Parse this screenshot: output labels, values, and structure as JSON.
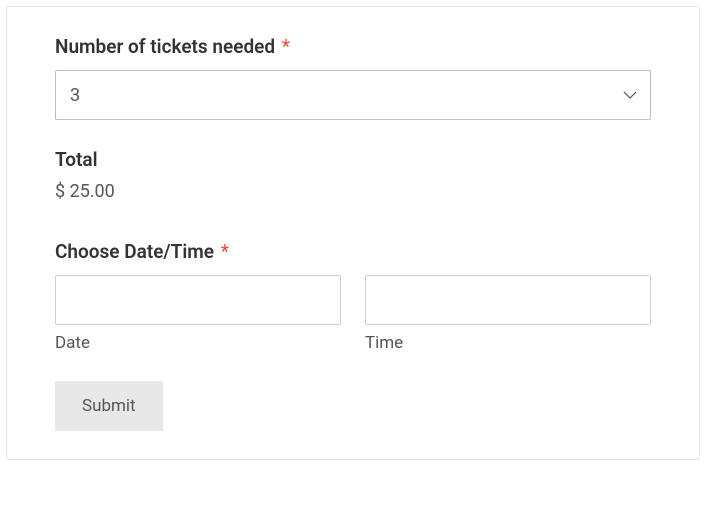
{
  "tickets": {
    "label": "Number of tickets needed",
    "required": "*",
    "value": "3"
  },
  "total": {
    "label": "Total",
    "value": "$ 25.00"
  },
  "datetime": {
    "label": "Choose Date/Time",
    "required": "*",
    "date_sublabel": "Date",
    "time_sublabel": "Time"
  },
  "submit": {
    "label": "Submit"
  }
}
